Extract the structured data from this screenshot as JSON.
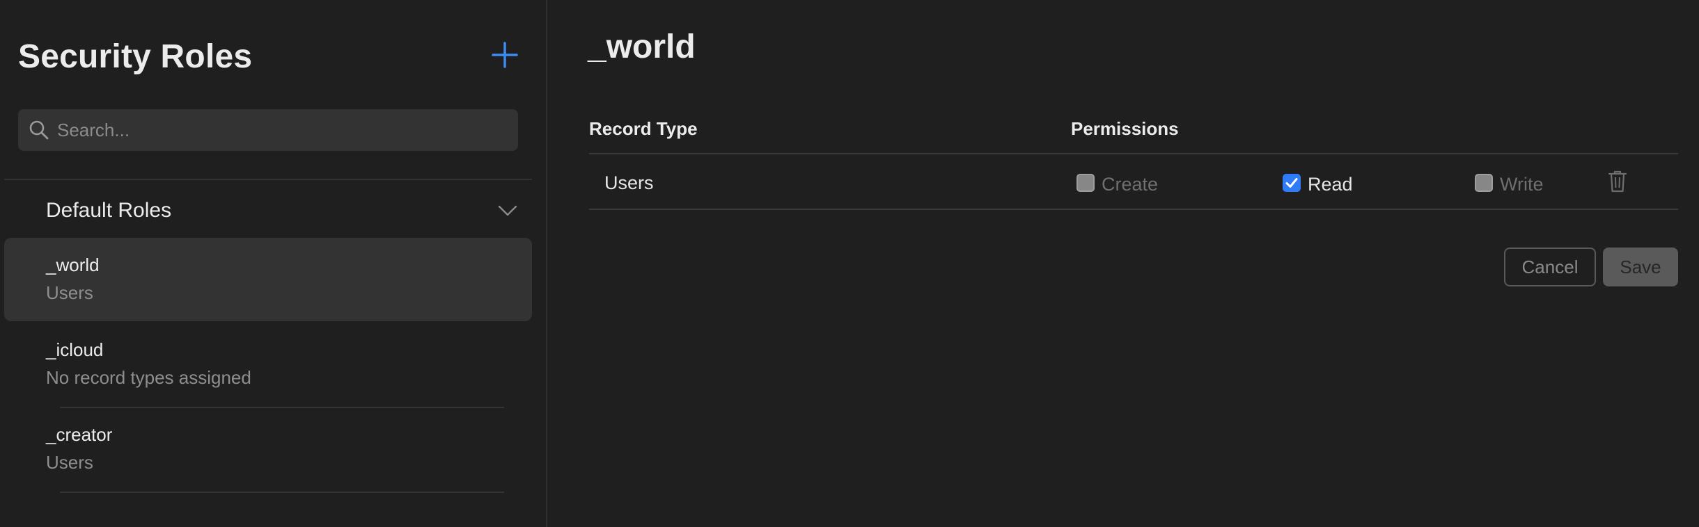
{
  "sidebar": {
    "title": "Security Roles",
    "add_icon": "plus-icon",
    "search": {
      "placeholder": "Search...",
      "value": ""
    },
    "group": {
      "label": "Default Roles",
      "expanded": true
    },
    "roles": [
      {
        "name": "_world",
        "subtitle": "Users",
        "selected": true
      },
      {
        "name": "_icloud",
        "subtitle": "No record types assigned",
        "selected": false
      },
      {
        "name": "_creator",
        "subtitle": "Users",
        "selected": false
      }
    ]
  },
  "main": {
    "title": "_world",
    "columns": {
      "record_type": "Record Type",
      "permissions": "Permissions"
    },
    "rows": [
      {
        "record_type": "Users",
        "permissions": [
          {
            "label": "Create",
            "checked": false
          },
          {
            "label": "Read",
            "checked": true
          },
          {
            "label": "Write",
            "checked": false
          }
        ],
        "delete_icon": "trash-icon"
      }
    ],
    "actions": {
      "cancel": "Cancel",
      "save": "Save"
    }
  },
  "colors": {
    "background": "#1f1f1f",
    "accent": "#2f7cf6",
    "selected_row": "#333333"
  }
}
